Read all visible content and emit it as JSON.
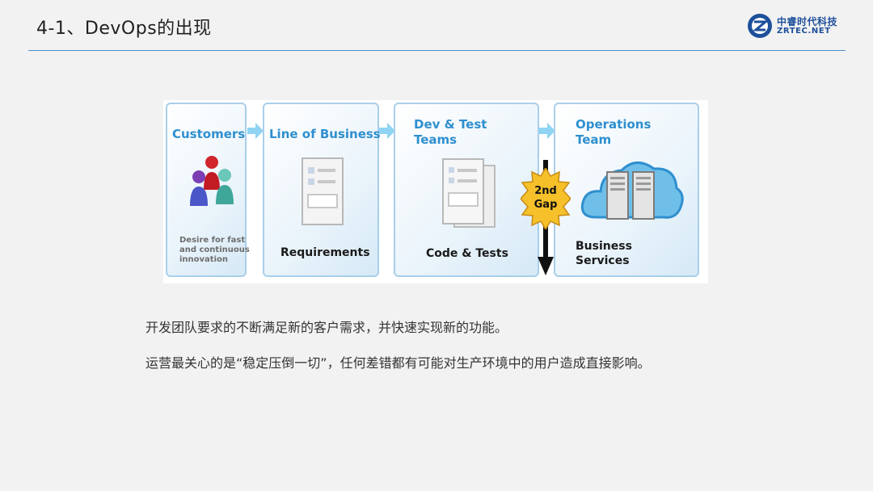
{
  "slide": {
    "title": "4-1、DevOps的出现"
  },
  "logo": {
    "cn": "中睿时代科技",
    "en": "ZRTEC.NET"
  },
  "diagram": {
    "panels": [
      {
        "title": "Customers",
        "caption": "Desire for fast and continuous innovation"
      },
      {
        "title": "Line of Business",
        "footer": "Requirements"
      },
      {
        "title": "Dev & Test Teams",
        "footer": "Code & Tests"
      },
      {
        "title": "Operations Team",
        "footer": "Business Services"
      }
    ],
    "gap_badge": "2nd Gap"
  },
  "body": {
    "line1": "开发团队要求的不断满足新的客户需求，并快速实现新的功能。",
    "line2": "运营最关心的是“稳定压倒一切”，任何差错都有可能对生产环境中的用户造成直接影响。"
  },
  "colors": {
    "title_rule": "#4d90c9",
    "panel_title": "#2f8fcf",
    "panel_border": "#a9cfea",
    "badge": "#f5c02a"
  }
}
